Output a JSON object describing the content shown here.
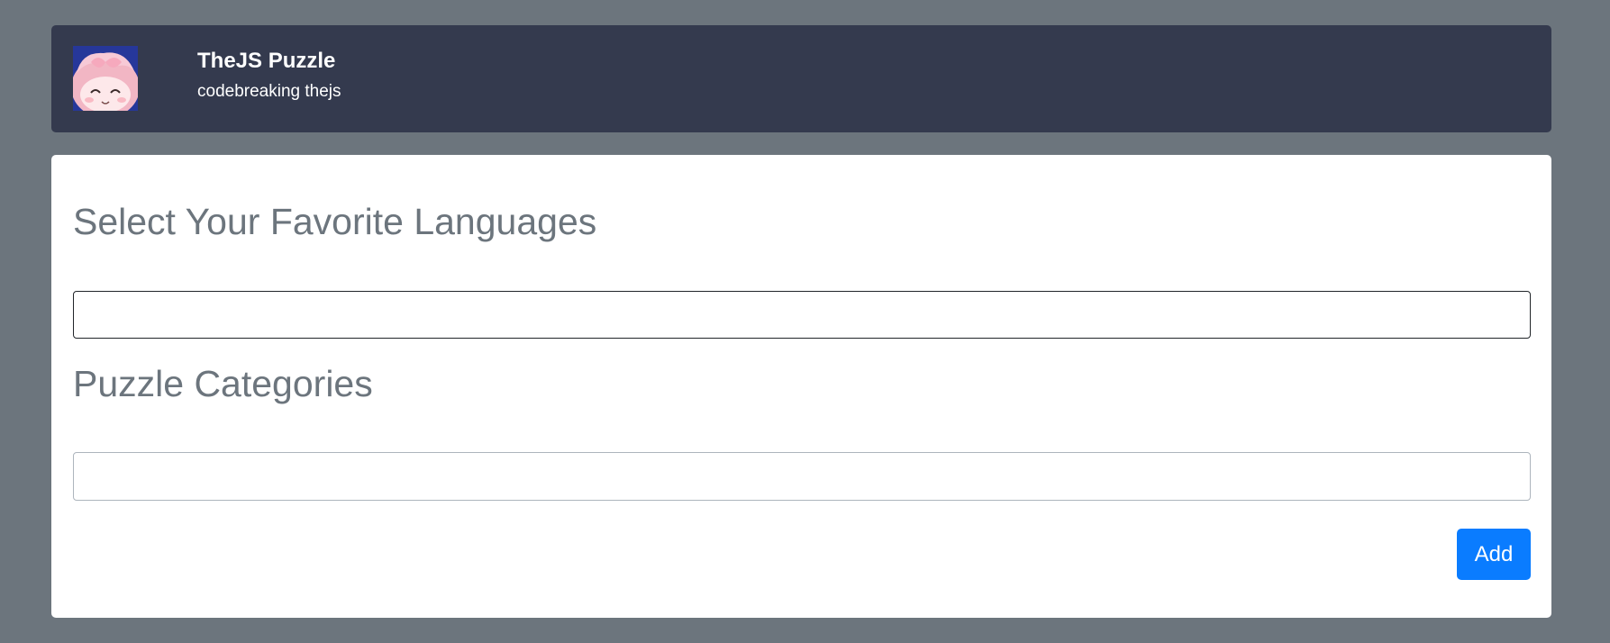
{
  "header": {
    "title": "TheJS Puzzle",
    "subtitle": "codebreaking thejs",
    "avatar_icon": "anime-avatar-image"
  },
  "main": {
    "languages_heading": "Select Your Favorite Languages",
    "languages_input": {
      "value": "",
      "placeholder": ""
    },
    "categories_heading": "Puzzle Categories",
    "categories_input": {
      "value": "",
      "placeholder": ""
    },
    "add_label": "Add"
  },
  "colors": {
    "background": "#6c757d",
    "header_bg": "#343a4e",
    "card_bg": "#ffffff",
    "heading_text": "#6c757d",
    "button_bg": "#0a7cff"
  }
}
